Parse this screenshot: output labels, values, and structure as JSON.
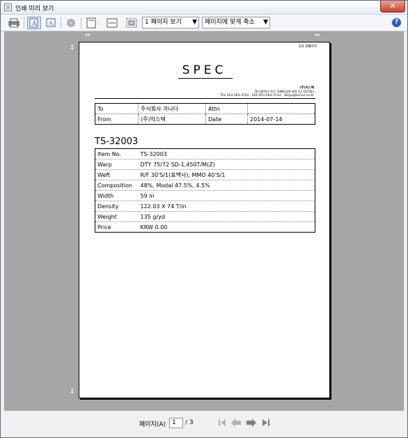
{
  "window": {
    "title": "인쇄 미리 보기",
    "close_label": "✕"
  },
  "toolbar": {
    "page_view": "1 페이지 보기",
    "zoom": "페이지에 맞게 축소",
    "help_label": "?"
  },
  "preview": {
    "page_indicator": "1의 3페이지",
    "title": "SPEC",
    "company_name": "(주)익스텍",
    "company_address": "대구광역시 서구 국채보상로 8길 11 (중리동)",
    "company_contact": "TEL 053-563-3722 , FAX 053-563-3724 , dotyu@ksnan.co.kr",
    "to_table": [
      [
        "To",
        "주식회사 가나다",
        "Attn",
        ""
      ],
      [
        "From",
        "(주)익스텍",
        "Date",
        "2014-07-14"
      ]
    ],
    "model": "TS-32003",
    "specs": [
      [
        "Item No.",
        "TS-32003"
      ],
      [
        "Warp",
        "DTY 75/72 SD-1,450T/M(Z)"
      ],
      [
        "Weft",
        "R/F 30'S/1(표백사), MMO 40'S/1"
      ],
      [
        "Composition",
        "48%, Modal 47.5%, 4.5%"
      ],
      [
        "Width",
        "59 in"
      ],
      [
        "Density",
        "122.03 X 74 T/in"
      ],
      [
        "Weight",
        "135 g/yd"
      ],
      [
        "Price",
        "KRW 0.00"
      ]
    ]
  },
  "statusbar": {
    "page_label": "페이지(A)",
    "current_page": "1",
    "total": "/ 3"
  }
}
